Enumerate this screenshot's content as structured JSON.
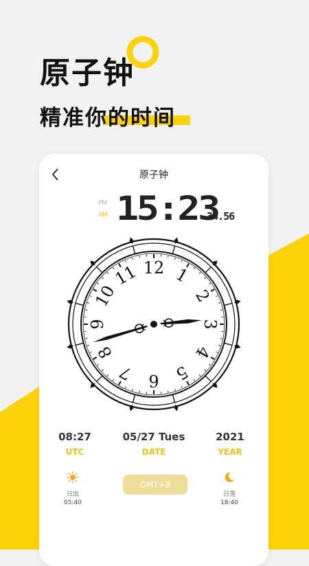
{
  "promo": {
    "headline": "原子钟",
    "subline": "精准你的时间"
  },
  "colors": {
    "accent_yellow": "#fbd20a",
    "label_yellow": "#f0c20f",
    "background": "#f2f2f2"
  },
  "screen": {
    "nav_title": "原子钟",
    "back_icon": "chevron-left-icon",
    "pm_label": "PM",
    "am_label": "AM",
    "time_main": "15:23",
    "time_seconds": "34.56",
    "clock": {
      "numerals": [
        "12",
        "1",
        "2",
        "3",
        "4",
        "5",
        "6",
        "7",
        "8",
        "9",
        "10",
        "11"
      ],
      "hour_hand_hour": 8.45,
      "minute_hand_minute": 14.2
    },
    "info": {
      "utc_value": "08:27",
      "utc_label": "UTC",
      "date_value": "05/27 Tues",
      "date_label": "DATE",
      "year_value": "2021",
      "year_label": "YEAR"
    },
    "sunrise": {
      "label": "日出",
      "time": "05:40",
      "icon": "sun-icon"
    },
    "sunset": {
      "label": "日落",
      "time": "18:40",
      "icon": "moon-icon"
    },
    "gmt_button_label": "GMT+8"
  }
}
